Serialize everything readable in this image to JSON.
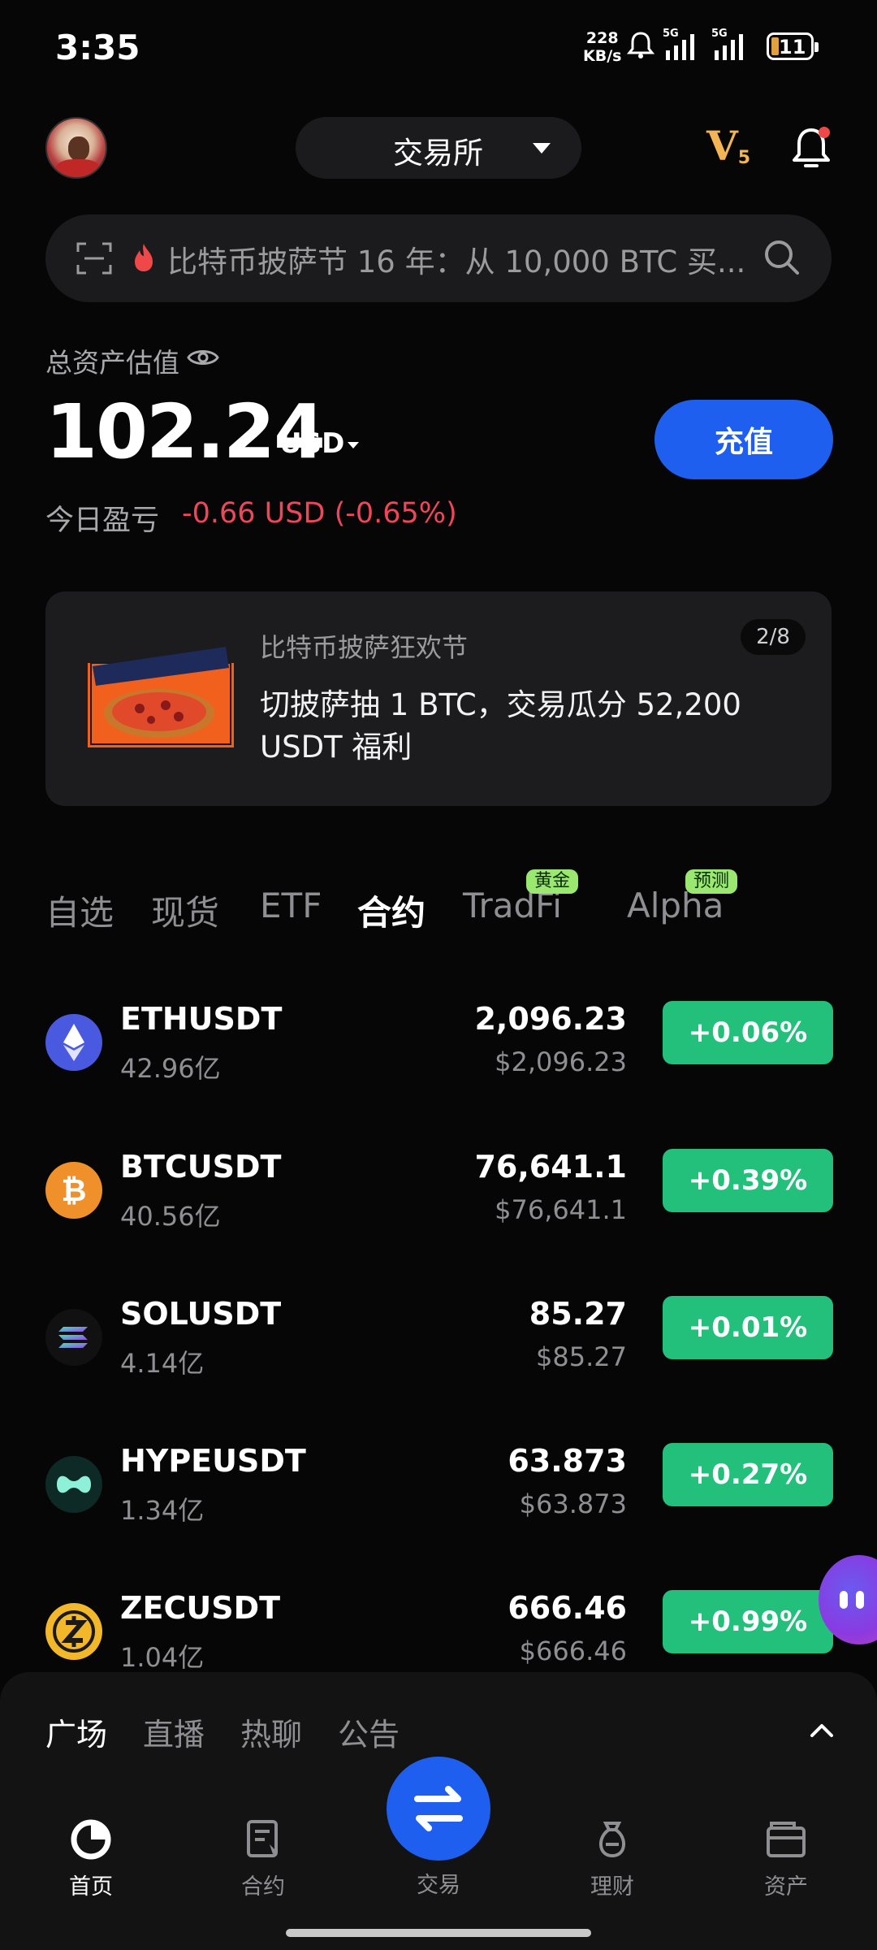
{
  "status_bar": {
    "time": "3:35",
    "net_speed": "228",
    "net_unit": "KB/s",
    "sim1": "5G",
    "sim2": "5G",
    "battery": "11"
  },
  "header": {
    "exchange_label": "交易所",
    "vip_level": "V",
    "vip_num": "5"
  },
  "search": {
    "text": "比特币披萨节 16 年：从 10,000 BTC 买..."
  },
  "assets": {
    "label": "总资产估值",
    "balance": "102.24",
    "currency": "USD",
    "deposit_label": "充值",
    "pnl_label": "今日盈亏",
    "pnl_value": "-0.66 USD (-0.65%)"
  },
  "banner": {
    "title": "比特币披萨狂欢节",
    "description": "切披萨抽 1 BTC，交易瓜分 52,200 USDT 福利",
    "pager": "2/8"
  },
  "market_tabs": [
    {
      "label": "自选",
      "badge": ""
    },
    {
      "label": "现货",
      "badge": ""
    },
    {
      "label": "ETF",
      "badge": ""
    },
    {
      "label": "合约",
      "badge": ""
    },
    {
      "label": "TradFi",
      "badge": "黄金"
    },
    {
      "label": "Alpha",
      "badge": "预测"
    }
  ],
  "active_tab": "合约",
  "market_rows": [
    {
      "pair": "ETHUSDT",
      "volume": "42.96亿",
      "price": "2,096.23",
      "price_usd": "$2,096.23",
      "change": "+0.06%",
      "icon": "ethereum-icon",
      "color": "#4a5ae0"
    },
    {
      "pair": "BTCUSDT",
      "volume": "40.56亿",
      "price": "76,641.1",
      "price_usd": "$76,641.1",
      "change": "+0.39%",
      "icon": "bitcoin-icon",
      "color": "#f0902a"
    },
    {
      "pair": "SOLUSDT",
      "volume": "4.14亿",
      "price": "85.27",
      "price_usd": "$85.27",
      "change": "+0.01%",
      "icon": "solana-icon",
      "color": "#111111"
    },
    {
      "pair": "HYPEUSDT",
      "volume": "1.34亿",
      "price": "63.873",
      "price_usd": "$63.873",
      "change": "+0.27%",
      "icon": "hyperliquid-icon",
      "color": "#0e2a26"
    },
    {
      "pair": "ZECUSDT",
      "volume": "1.04亿",
      "price": "666.46",
      "price_usd": "$666.46",
      "change": "+0.99%",
      "icon": "zcash-icon",
      "color": "#f3b72a"
    }
  ],
  "feed_tabs": [
    "广场",
    "直播",
    "热聊",
    "公告"
  ],
  "bottom_nav": [
    {
      "label": "首页",
      "icon": "home-icon"
    },
    {
      "label": "合约",
      "icon": "futures-icon"
    },
    {
      "label": "交易",
      "icon": "swap-icon"
    },
    {
      "label": "理财",
      "icon": "earn-icon"
    },
    {
      "label": "资产",
      "icon": "wallet-icon"
    }
  ],
  "colors": {
    "accent_blue": "#1f5ff0",
    "up_green": "#22c07a",
    "down_red": "#f0465a",
    "vip_gold": "#f2b455",
    "badge_green": "#9be870"
  }
}
